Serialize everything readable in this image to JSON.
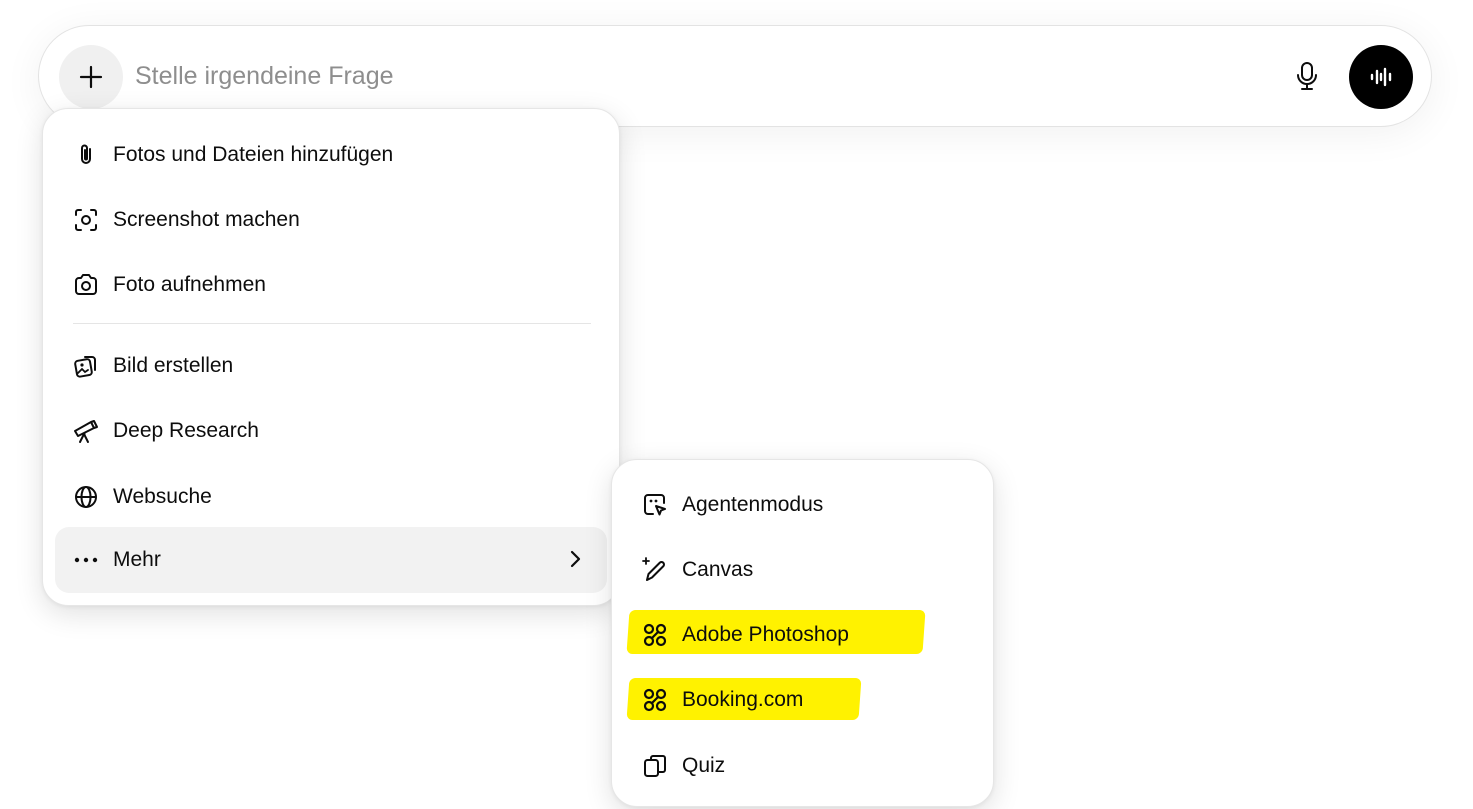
{
  "composer": {
    "placeholder": "Stelle irgendeine Frage",
    "value": "",
    "plus_icon": "plus-icon",
    "mic_icon": "microphone-icon",
    "voice_icon": "voice-waveform-icon"
  },
  "attach_menu": {
    "items": [
      {
        "label": "Fotos und Dateien hinzufügen",
        "icon": "paperclip-icon"
      },
      {
        "label": "Screenshot machen",
        "icon": "screenshot-icon"
      },
      {
        "label": "Foto aufnehmen",
        "icon": "camera-icon"
      },
      {
        "label": "Bild erstellen",
        "icon": "image-create-icon"
      },
      {
        "label": "Deep Research",
        "icon": "telescope-icon"
      },
      {
        "label": "Websuche",
        "icon": "globe-icon"
      }
    ],
    "more": {
      "label": "Mehr",
      "icon": "ellipsis-icon",
      "chevron": "chevron-right-icon"
    }
  },
  "more_menu": {
    "items": [
      {
        "label": "Agentenmodus",
        "icon": "agent-cursor-icon",
        "highlighted": false
      },
      {
        "label": "Canvas",
        "icon": "pencil-sparkle-icon",
        "highlighted": false
      },
      {
        "label": "Adobe Photoshop",
        "icon": "command-key-icon",
        "highlighted": true
      },
      {
        "label": "Booking.com",
        "icon": "command-key-icon",
        "highlighted": true
      },
      {
        "label": "Quiz",
        "icon": "cards-icon",
        "highlighted": false
      }
    ],
    "highlight_color": "#fff200"
  }
}
